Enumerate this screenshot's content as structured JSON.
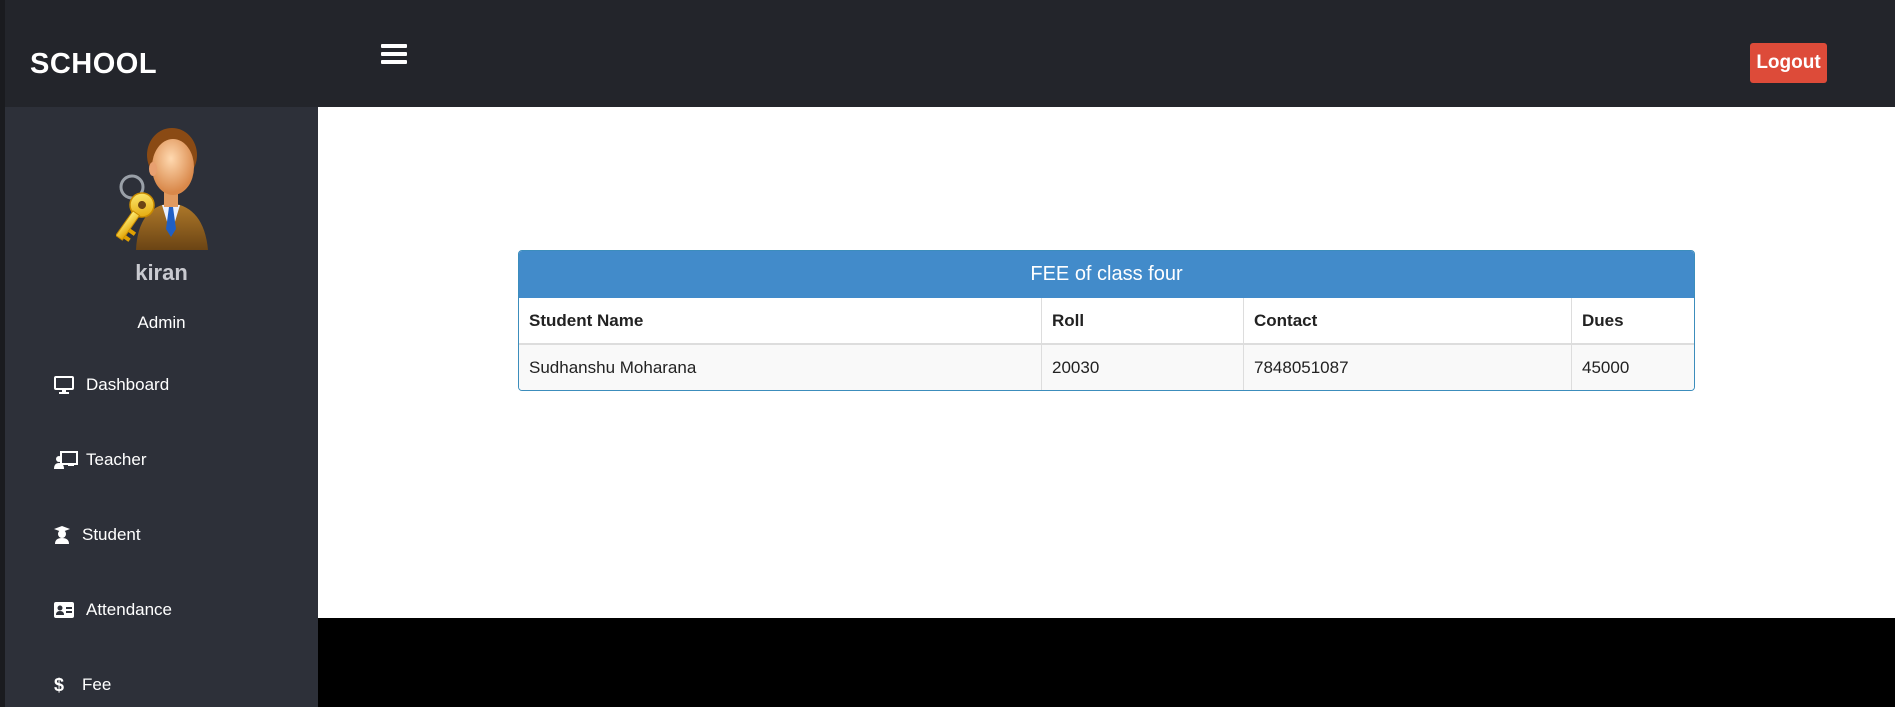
{
  "header": {
    "brand": "SCHOOL",
    "logout_label": "Logout"
  },
  "user": {
    "name": "kiran",
    "role": "Admin"
  },
  "sidebar": {
    "items": [
      {
        "label": "Dashboard",
        "icon": "desktop-icon"
      },
      {
        "label": "Teacher",
        "icon": "chalkboard-teacher-icon"
      },
      {
        "label": "Student",
        "icon": "user-graduate-icon"
      },
      {
        "label": "Attendance",
        "icon": "id-card-icon"
      },
      {
        "label": "Fee",
        "icon": "dollar-icon"
      }
    ]
  },
  "fee_panel": {
    "title": "FEE of class four",
    "columns": [
      "Student Name",
      "Roll",
      "Contact",
      "Dues"
    ],
    "rows": [
      [
        "Sudhanshu Moharana",
        "20030",
        "7848051087",
        "45000"
      ]
    ]
  },
  "colors": {
    "topbar": "#23252b",
    "sidebar": "#2d3039",
    "panel_heading": "#428bca",
    "logout": "#dd4b39"
  }
}
